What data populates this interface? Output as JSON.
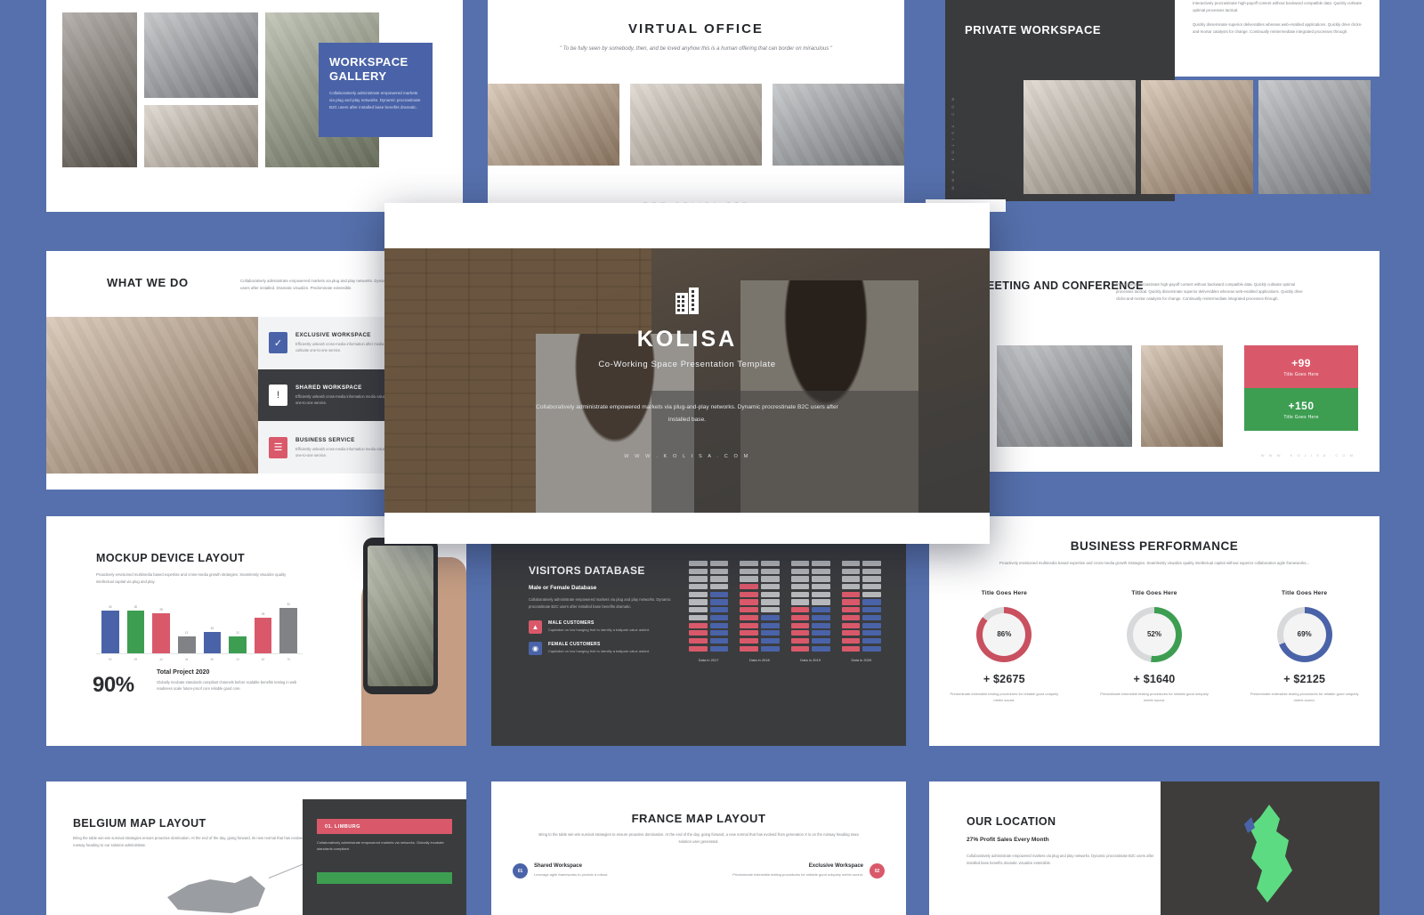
{
  "theme": {
    "background": "#5570ac",
    "accent_blue": "#4a63a8",
    "accent_red": "#d9596a",
    "accent_green": "#46a05a",
    "dark": "#3b3c3e",
    "light": "#f2f3f4"
  },
  "hero": {
    "logo_icon": "office-building-icon",
    "brand": "KOLISA",
    "tagline": "Co-Working Space Presentation Template",
    "description": "Collaboratively administrate empowered markets via plug-and-play networks. Dynamic procrestinate B2C users after installed base.",
    "url": "W W W . K O L I S A . C O M"
  },
  "slide_gallery": {
    "title": "WORKSPACE GALLERY",
    "body": "Collaboratively administrate empowered markets via plug and play networks. Dynamic procrastinate B2C users after installed base benefits dramatic."
  },
  "slide_virtual_office": {
    "title": "VIRTUAL OFFICE",
    "quote": "\" To be fully seen by somebody, then, and be loved anyhow this is a human offering that can border on miraculous \"",
    "footer": "W W W . K O L I S A . C O M"
  },
  "slide_private_workspace": {
    "title": "PRIVATE WORKSPACE",
    "vertical_url": "W W W . K O L I S A . C O M",
    "paragraph_1": "Interactively procrastinate high-payoff content without backward compatible data. Quickly cultivate optimal processes tactical.",
    "paragraph_2": "Quickly disseminate superior deliverables whereas web-enabled applications. Quickly drive clicks-and-mortar catalysts for change. Continually reintermediate integrated processes through."
  },
  "slide_what_we_do": {
    "title": "WHAT WE DO",
    "body": "Collaboratively administrate empowered markets via plug and play networks. Dynamic procrastinate B2C users after installed. Dramatic visualize. Predominate extensible.",
    "items": [
      {
        "icon": "check-clipboard-icon",
        "label": "EXCLUSIVE WORKSPACE",
        "text": "Efficiently unleash cross-media information after media value. Quickly maximize timely time cultivate one-to-one service.",
        "color": "#4a63a8",
        "theme": "light"
      },
      {
        "icon": "alert-clipboard-icon",
        "label": "SHARED WORKSPACE",
        "text": "Efficiently unleash cross-media information media value. Quickly maximize timely time cultivate one-to-one service.",
        "color": "#ffffff",
        "theme": "dark"
      },
      {
        "icon": "list-clipboard-icon",
        "label": "BUSINESS SERVICE",
        "text": "Efficiently unleash cross-media information media value. Quickly maximize timely time cultivate one-to-one service.",
        "color": "#d9596a",
        "theme": "light"
      }
    ]
  },
  "slide_meeting": {
    "title": "MEETING AND CONFERENCE",
    "body": "Interactively procrastinate high-payoff content without backward compatible data. Quickly cultivate optimal processes tactical. Quickly disseminate superior deliverables whereas web-enabled applications. Quickly drive clicks-and-mortar catalysts for change. Continually reintermediate integrated processes through.",
    "stats": [
      {
        "value": "+99",
        "label": "Title Goes Here",
        "color": "#d9596a"
      },
      {
        "value": "+150",
        "label": "Title Goes Here",
        "color": "#3d9e52"
      }
    ],
    "footer": "W W W . K O L I S A . C O M"
  },
  "slide_mockup": {
    "title": "MOCKUP DEVICE LAYOUT",
    "body": "Proactively envisioned multimedia based expertise and cross-media growth strategies. Seamlessly visualize quality intellectual capital via plug and play.",
    "percent": "90%",
    "sub_title": "Total Project 2020",
    "sub_body": "Globally incubate standards compliant channels before scalable benefits testing in web readiness scale future-proof core reliable good core.",
    "chart_data": {
      "type": "bar",
      "title": "MOCKUP DEVICE LAYOUT",
      "categories": [
        "90",
        "09",
        "44",
        "44",
        "40",
        "14",
        "40",
        "70"
      ],
      "values": [
        30,
        30,
        28,
        12,
        15,
        12,
        25,
        32
      ],
      "colors": [
        "#4a63a8",
        "#3d9e52",
        "#d9596a",
        "#808285",
        "#4a63a8",
        "#3d9e52",
        "#d9596a",
        "#808285"
      ],
      "xlabel": "",
      "ylabel": "",
      "ylim": [
        0,
        35
      ],
      "grid": false,
      "legend": "none"
    }
  },
  "slide_visitors": {
    "title": "VISITORS DATABASE",
    "subtitle": "Male or Female Database",
    "body": "Collaboratively administrate empowered markets via plug and play networks. Dynamic procrastinate B2C users after installed base benefits dramatic.",
    "legend": [
      {
        "icon": "male-customers-icon",
        "label": "MALE CUSTOMERS",
        "text": "Capitalize on low hanging fruit to identify a ballpark value added.",
        "color": "#d9596a"
      },
      {
        "icon": "female-customers-icon",
        "label": "FEMALE CUSTOMERS",
        "text": "Capitalize on low hanging fruit to identify a ballpark value added.",
        "color": "#4a63a8"
      }
    ],
    "chart_data": {
      "type": "bar",
      "title": "VISITORS DATABASE",
      "categories": [
        "Data in 2017",
        "Data in 2018",
        "Data in 2019",
        "Data in 2020"
      ],
      "series": [
        {
          "name": "MALE CUSTOMERS",
          "color": "#d9596a",
          "values": [
            4,
            9,
            6,
            8
          ]
        },
        {
          "name": "FEMALE CUSTOMERS",
          "color": "#4a63a8",
          "values": [
            8,
            5,
            6,
            7
          ]
        }
      ],
      "segments_total": 12,
      "empty_color": "#b6b8bb",
      "ylabel": "",
      "xlabel": "",
      "grid": false,
      "legend": "left"
    }
  },
  "slide_performance": {
    "title": "BUSINESS PERFORMANCE",
    "body": "Proactively envisioned multimedia based expertise and cross-media growth strategies. Seamlessly visualize quality intellectual capital without superior collaboration agile frameworks...",
    "chart_data": {
      "type": "pie",
      "title": "BUSINESS PERFORMANCE",
      "items": [
        {
          "label": "Title Goes Here",
          "percent": 86,
          "percent_text": "86%",
          "amount": "+ $2675",
          "color": "#c9505f",
          "note": "Predominate extensible testing procedures for reliable good uniquely metrix sound."
        },
        {
          "label": "Title Goes Here",
          "percent": 52,
          "percent_text": "52%",
          "amount": "+ $1640",
          "color": "#3d9e52",
          "note": "Predominate extensible testing procedures for reliable good uniquely metrix sound."
        },
        {
          "label": "Title Goes Here",
          "percent": 69,
          "percent_text": "69%",
          "amount": "+ $2125",
          "color": "#4a63a8",
          "note": "Predominate extensible testing procedures for reliable good uniquely metrix sound."
        }
      ],
      "legend": "none",
      "grid": false
    }
  },
  "slide_belgium": {
    "title": "BELGIUM MAP LAYOUT",
    "body": "Bring the table win-win survival strategies ensure proactive domination. At the end of the day, going forward, its new normal that has evolved from runway heading to our solution administrate.",
    "badge": "01. LIMBURG",
    "badge_color": "#d9596a",
    "badge_body": "Collaboratively administrate empowered markets via networks. Globally incubate standards compliant.",
    "badge2_color": "#3d9e52"
  },
  "slide_france": {
    "title": "FRANCE MAP LAYOUT",
    "body": "Bring to the table win-win survival strategies to ensure proactive domination. At the end of the day, going forward, a new normal that has evolved from generation X is on the runway heading towa solution user generated.",
    "points": [
      {
        "num": "01",
        "name": "Shared Workspace",
        "text": "Leverage agile frameworks to provide a robust.",
        "color": "#4a63a8"
      },
      {
        "num": "02",
        "name": "Exclusive Workspace",
        "text": "Predominate extensible testing procedures for reliable good uniquely metrix sound.",
        "color": "#d9596a"
      }
    ]
  },
  "slide_location": {
    "title": "OUR LOCATION",
    "subtitle": "27% Profit Sales Every Month",
    "body": "Collaboratively administrate empowered markets via plug and play networks. Dynamic procrastinate B2C users after installed base benefits dramatic visualize extensible."
  }
}
